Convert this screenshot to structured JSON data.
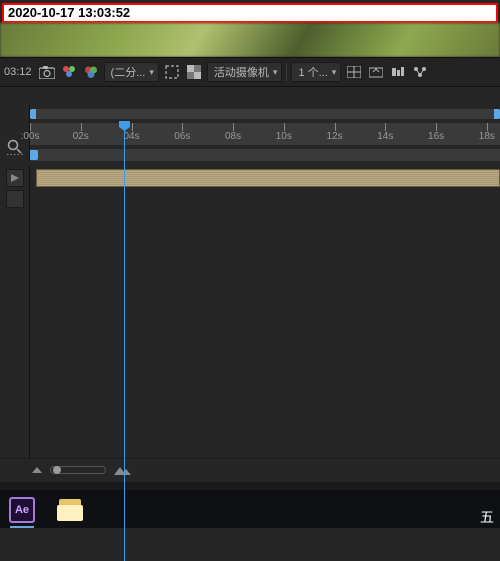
{
  "overlay": {
    "timestamp": "2020-10-17 13:03:52"
  },
  "viewer_toolbar": {
    "timecode": "03:12",
    "resolution": "(二分...",
    "camera": "活动摄像机",
    "views": "1 个..."
  },
  "timeline": {
    "playhead_pct": 20.0,
    "ticks": [
      {
        "label": ":00s",
        "pct": 0
      },
      {
        "label": "02s",
        "pct": 10.8
      },
      {
        "label": "04s",
        "pct": 21.6
      },
      {
        "label": "06s",
        "pct": 32.4
      },
      {
        "label": "08s",
        "pct": 43.2
      },
      {
        "label": "10s",
        "pct": 54.0
      },
      {
        "label": "12s",
        "pct": 64.8
      },
      {
        "label": "14s",
        "pct": 75.6
      },
      {
        "label": "16s",
        "pct": 86.4
      },
      {
        "label": "18s",
        "pct": 97.2
      }
    ]
  },
  "taskbar": {
    "ae_label": "Ae",
    "ime": "五"
  }
}
